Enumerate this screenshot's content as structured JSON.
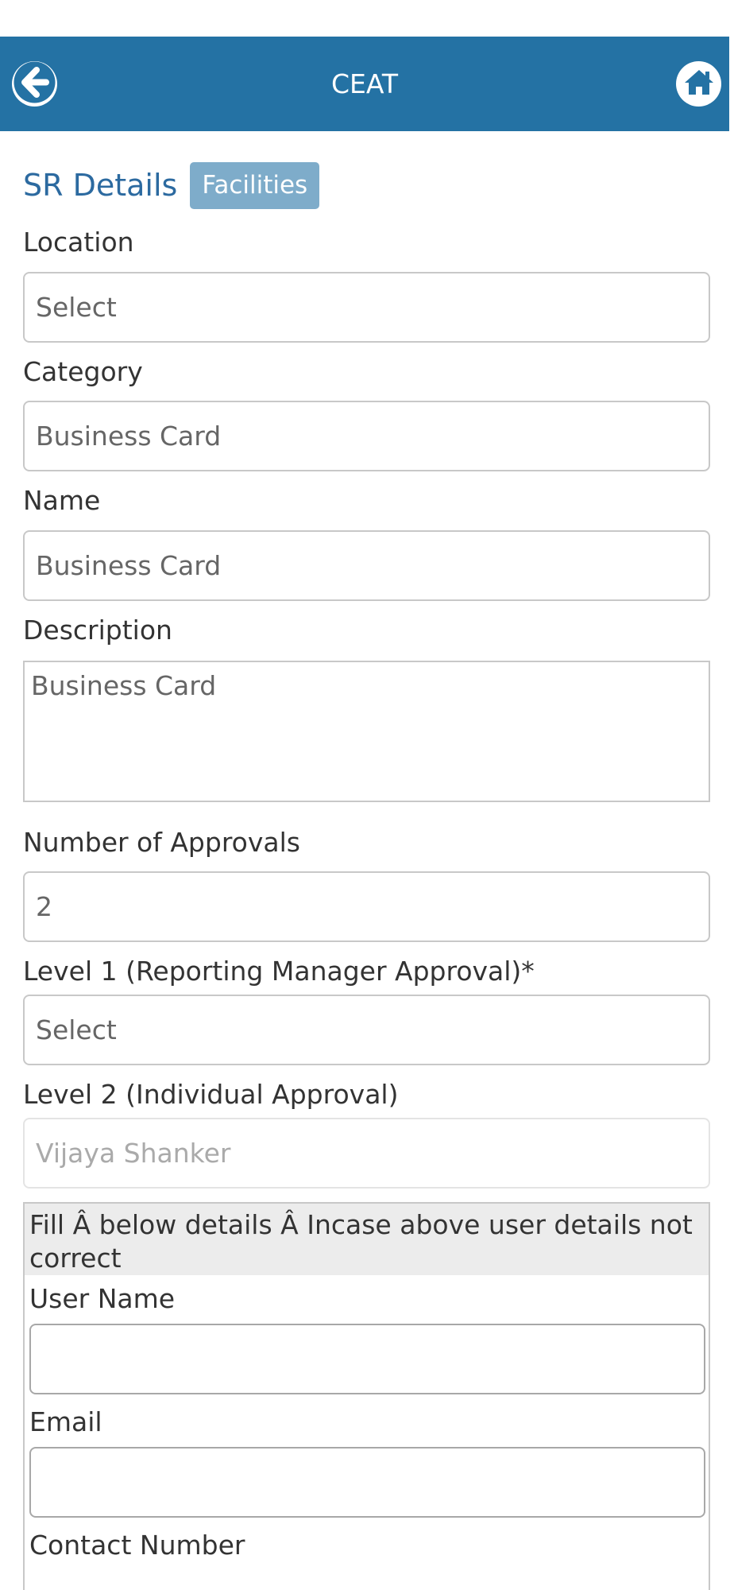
{
  "app_bar": {
    "title": "CEAT",
    "back_icon": "arrow-left-circle-icon",
    "home_icon": "home-icon",
    "color": "#2472a4"
  },
  "heading": {
    "title": "SR Details",
    "badge": "Facilities"
  },
  "form": {
    "location": {
      "label": "Location",
      "value": "Select"
    },
    "category": {
      "label": "Category",
      "value": "Business Card"
    },
    "name": {
      "label": "Name",
      "value": "Business Card"
    },
    "description": {
      "label": "Description",
      "value": "Business Card"
    },
    "approvals": {
      "label": "Number of Approvals",
      "value": "2"
    },
    "level1": {
      "label": "Level 1 (Reporting Manager Approval)*",
      "value": "Select"
    },
    "level2": {
      "label": "Level 2 (Individual Approval)",
      "value": "Vijaya Shanker"
    }
  },
  "alt_user": {
    "note": "Fill Â below details Â Incase above user details not correct",
    "user_name_label": "User Name",
    "user_name_value": "",
    "email_label": "Email",
    "email_value": "",
    "contact_label": "Contact Number"
  }
}
